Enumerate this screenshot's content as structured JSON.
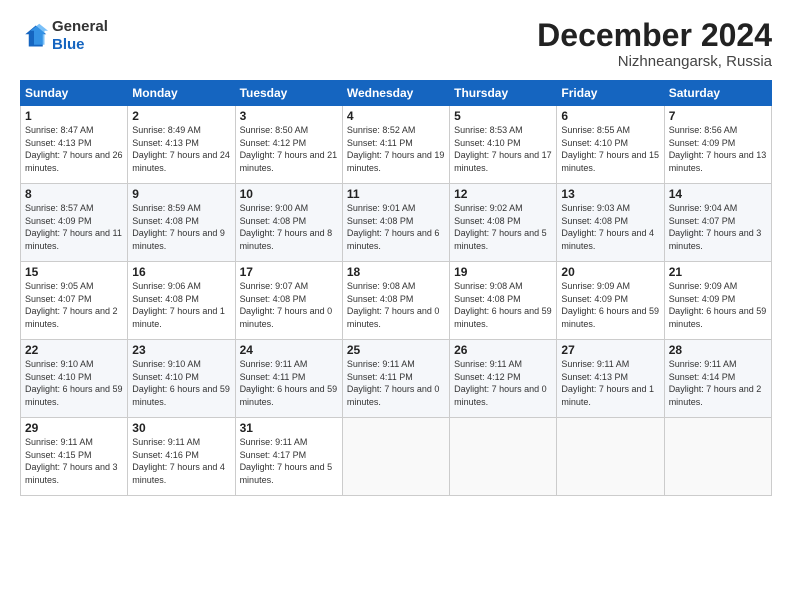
{
  "header": {
    "logo_line1": "General",
    "logo_line2": "Blue",
    "month_title": "December 2024",
    "location": "Nizhneangarsk, Russia"
  },
  "days_of_week": [
    "Sunday",
    "Monday",
    "Tuesday",
    "Wednesday",
    "Thursday",
    "Friday",
    "Saturday"
  ],
  "weeks": [
    [
      {
        "day": "1",
        "rise": "8:47 AM",
        "set": "4:13 PM",
        "daylight": "7 hours and 26 minutes."
      },
      {
        "day": "2",
        "rise": "8:49 AM",
        "set": "4:13 PM",
        "daylight": "7 hours and 24 minutes."
      },
      {
        "day": "3",
        "rise": "8:50 AM",
        "set": "4:12 PM",
        "daylight": "7 hours and 21 minutes."
      },
      {
        "day": "4",
        "rise": "8:52 AM",
        "set": "4:11 PM",
        "daylight": "7 hours and 19 minutes."
      },
      {
        "day": "5",
        "rise": "8:53 AM",
        "set": "4:10 PM",
        "daylight": "7 hours and 17 minutes."
      },
      {
        "day": "6",
        "rise": "8:55 AM",
        "set": "4:10 PM",
        "daylight": "7 hours and 15 minutes."
      },
      {
        "day": "7",
        "rise": "8:56 AM",
        "set": "4:09 PM",
        "daylight": "7 hours and 13 minutes."
      }
    ],
    [
      {
        "day": "8",
        "rise": "8:57 AM",
        "set": "4:09 PM",
        "daylight": "7 hours and 11 minutes."
      },
      {
        "day": "9",
        "rise": "8:59 AM",
        "set": "4:08 PM",
        "daylight": "7 hours and 9 minutes."
      },
      {
        "day": "10",
        "rise": "9:00 AM",
        "set": "4:08 PM",
        "daylight": "7 hours and 8 minutes."
      },
      {
        "day": "11",
        "rise": "9:01 AM",
        "set": "4:08 PM",
        "daylight": "7 hours and 6 minutes."
      },
      {
        "day": "12",
        "rise": "9:02 AM",
        "set": "4:08 PM",
        "daylight": "7 hours and 5 minutes."
      },
      {
        "day": "13",
        "rise": "9:03 AM",
        "set": "4:08 PM",
        "daylight": "7 hours and 4 minutes."
      },
      {
        "day": "14",
        "rise": "9:04 AM",
        "set": "4:07 PM",
        "daylight": "7 hours and 3 minutes."
      }
    ],
    [
      {
        "day": "15",
        "rise": "9:05 AM",
        "set": "4:07 PM",
        "daylight": "7 hours and 2 minutes."
      },
      {
        "day": "16",
        "rise": "9:06 AM",
        "set": "4:08 PM",
        "daylight": "7 hours and 1 minute."
      },
      {
        "day": "17",
        "rise": "9:07 AM",
        "set": "4:08 PM",
        "daylight": "7 hours and 0 minutes."
      },
      {
        "day": "18",
        "rise": "9:08 AM",
        "set": "4:08 PM",
        "daylight": "7 hours and 0 minutes."
      },
      {
        "day": "19",
        "rise": "9:08 AM",
        "set": "4:08 PM",
        "daylight": "6 hours and 59 minutes."
      },
      {
        "day": "20",
        "rise": "9:09 AM",
        "set": "4:09 PM",
        "daylight": "6 hours and 59 minutes."
      },
      {
        "day": "21",
        "rise": "9:09 AM",
        "set": "4:09 PM",
        "daylight": "6 hours and 59 minutes."
      }
    ],
    [
      {
        "day": "22",
        "rise": "9:10 AM",
        "set": "4:10 PM",
        "daylight": "6 hours and 59 minutes."
      },
      {
        "day": "23",
        "rise": "9:10 AM",
        "set": "4:10 PM",
        "daylight": "6 hours and 59 minutes."
      },
      {
        "day": "24",
        "rise": "9:11 AM",
        "set": "4:11 PM",
        "daylight": "6 hours and 59 minutes."
      },
      {
        "day": "25",
        "rise": "9:11 AM",
        "set": "4:11 PM",
        "daylight": "7 hours and 0 minutes."
      },
      {
        "day": "26",
        "rise": "9:11 AM",
        "set": "4:12 PM",
        "daylight": "7 hours and 0 minutes."
      },
      {
        "day": "27",
        "rise": "9:11 AM",
        "set": "4:13 PM",
        "daylight": "7 hours and 1 minute."
      },
      {
        "day": "28",
        "rise": "9:11 AM",
        "set": "4:14 PM",
        "daylight": "7 hours and 2 minutes."
      }
    ],
    [
      {
        "day": "29",
        "rise": "9:11 AM",
        "set": "4:15 PM",
        "daylight": "7 hours and 3 minutes."
      },
      {
        "day": "30",
        "rise": "9:11 AM",
        "set": "4:16 PM",
        "daylight": "7 hours and 4 minutes."
      },
      {
        "day": "31",
        "rise": "9:11 AM",
        "set": "4:17 PM",
        "daylight": "7 hours and 5 minutes."
      },
      null,
      null,
      null,
      null
    ]
  ]
}
